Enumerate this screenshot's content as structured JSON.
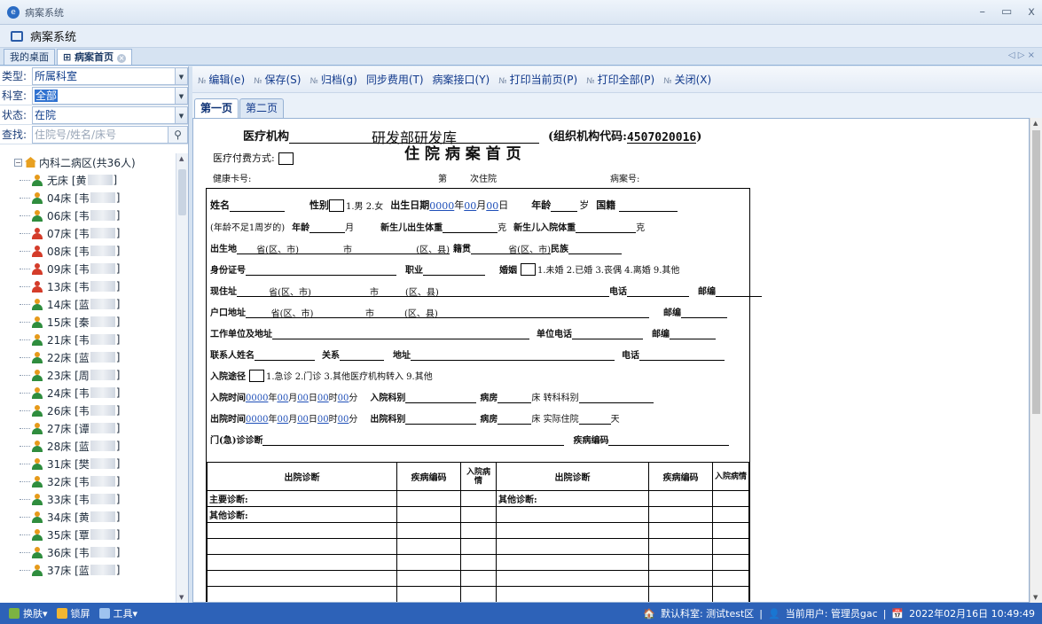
{
  "window": {
    "title": "病案系统"
  },
  "app": {
    "name": "病案系统"
  },
  "tabs": [
    {
      "label": "我的桌面"
    },
    {
      "label": "病案首页"
    }
  ],
  "filters": {
    "type_label": "类型:",
    "type_value": "所属科室",
    "dept_label": "科室:",
    "dept_value": "全部",
    "status_label": "状态:",
    "status_value": "在院",
    "search_label": "查找:",
    "search_placeholder": "住院号/姓名/床号"
  },
  "tree": {
    "root": "内科二病区(共36人)",
    "items": [
      {
        "bed": "无床 [黄",
        "end": "]"
      },
      {
        "bed": "04床 [韦",
        "end": "]"
      },
      {
        "bed": "06床 [韦",
        "end": "]"
      },
      {
        "bed": "07床 [韦",
        "end": "]"
      },
      {
        "bed": "08床 [韦",
        "end": "]"
      },
      {
        "bed": "09床 [韦",
        "end": "]"
      },
      {
        "bed": "13床 [韦",
        "end": "]"
      },
      {
        "bed": "14床 [蓝",
        "end": "]"
      },
      {
        "bed": "15床 [秦",
        "end": "]"
      },
      {
        "bed": "21床 [韦",
        "end": "]"
      },
      {
        "bed": "22床 [蓝",
        "end": "]"
      },
      {
        "bed": "23床 [周",
        "end": "]"
      },
      {
        "bed": "24床 [韦",
        "end": "]"
      },
      {
        "bed": "26床 [韦",
        "end": "]"
      },
      {
        "bed": "27床 [谭",
        "end": "]"
      },
      {
        "bed": "28床 [蓝",
        "end": "]"
      },
      {
        "bed": "31床 [樊",
        "end": "]"
      },
      {
        "bed": "32床 [韦",
        "end": "]"
      },
      {
        "bed": "33床 [韦",
        "end": "]"
      },
      {
        "bed": "34床 [黄",
        "end": "]"
      },
      {
        "bed": "35床 [覃",
        "end": "]"
      },
      {
        "bed": "36床 [韦",
        "end": "]"
      },
      {
        "bed": "37床 [蓝",
        "end": "]"
      }
    ]
  },
  "toolbar": {
    "edit": "编辑(e)",
    "save": "保存(S)",
    "archive": "归档(g)",
    "sync": "同步费用(T)",
    "iface": "病案接口(Y)",
    "print_page": "打印当前页(P)",
    "print_all": "打印全部(P)",
    "close": "关闭(X)"
  },
  "page_tabs": [
    "第一页",
    "第二页"
  ],
  "doc": {
    "org_label": "医疗机构",
    "org_value": "研发部研发库",
    "org_code": "(组织机构代码:",
    "org_code_value": "4507020016",
    "org_code_end": ")",
    "pay": "医疗付费方式:",
    "title": "住 院 病 案 首 页",
    "health": "健康卡号:",
    "nth": "第",
    "nth_end": "次住院",
    "case_no": "病案号:",
    "name": "姓名",
    "sex": "性别",
    "sex_opts": "1.男 2.女",
    "birth": "出生日期",
    "year0": "0000",
    "nian": "年",
    "m00": "00",
    "yue": "月",
    "ri": "日",
    "age": "年龄",
    "sui": "岁",
    "nation": "国籍",
    "infant_note": "(年龄不足1周岁的)",
    "age2": "年龄",
    "month": "月",
    "nb_weight": "新生儿出生体重",
    "ke": "克",
    "nb_in_weight": "新生儿入院体重",
    "birthplace": "出生地",
    "prov": "省(区、市)",
    "city": "市",
    "county": "(区、县)",
    "native": "籍贯",
    "ethnic": "民族",
    "id": "身份证号",
    "job": "职业",
    "marriage": "婚姻",
    "mar_opts": "1.未婚 2.已婚 3.丧偶 4.离婚 9.其他",
    "addr": "现住址",
    "phone": "电话",
    "zip": "邮编",
    "hukou": "户口地址",
    "work": "工作单位及地址",
    "work_phone": "单位电话",
    "contact": "联系人姓名",
    "relation": "关系",
    "address": "地址",
    "route": "入院途径",
    "route_opts": "1.急诊 2.门诊 3.其他医疗机构转入 9.其他",
    "admit_time": "入院时间",
    "shi": "时",
    "fen": "分",
    "admit_dept": "入院科别",
    "ward": "病房",
    "bed_transfer": "床 转科科别",
    "dis_time": "出院时间",
    "dis_dept": "出院科别",
    "bed_actual": "床 实际住院",
    "tian": "天",
    "outpatient": "门(急)诊诊断",
    "dcode": "疾病编码",
    "t_diag": "出院诊断",
    "t_code": "疾病编码",
    "t_cond": "入院病情",
    "main_diag": "主要诊断:",
    "other_diag": "其他诊断:"
  },
  "status": {
    "dept": "默认科室: 测试test区",
    "user": "当前用户: 管理员gac",
    "date": "2022年02月16日 10:49:49",
    "skin": "换肤",
    "lock": "锁屏",
    "tools": "工具"
  }
}
